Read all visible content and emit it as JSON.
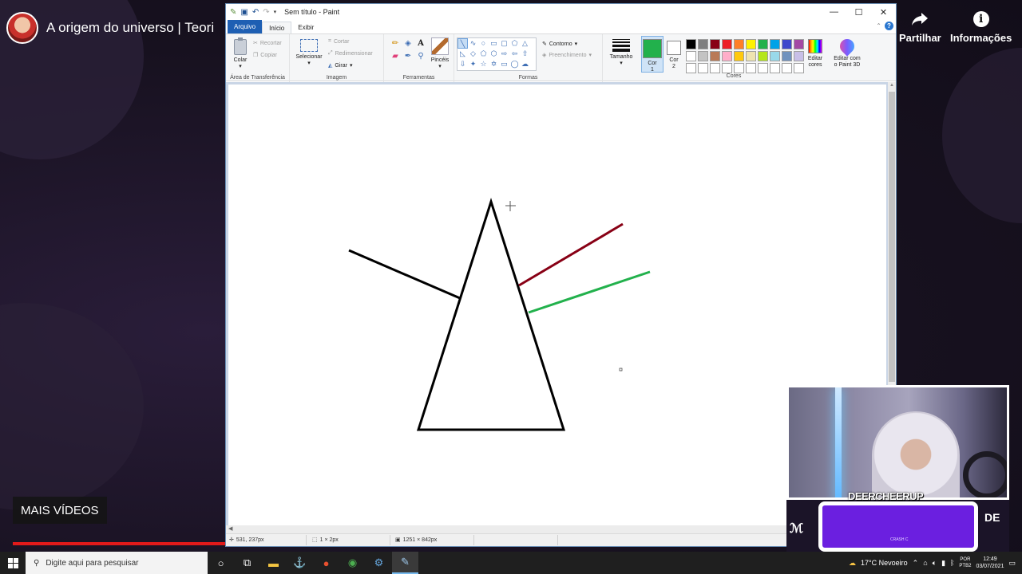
{
  "youtube": {
    "video_title": "A origem do universo | Teori",
    "share_label": "Partilhar",
    "info_label": "Informações",
    "more_videos": "MAIS VÍDEOS"
  },
  "paint": {
    "window_title": "Sem título - Paint",
    "tabs": [
      "Arquivo",
      "Início",
      "Exibir"
    ],
    "clipboard": {
      "paste": "Colar",
      "cut": "Recortar",
      "copy": "Copiar",
      "label": "Área de Transferência"
    },
    "image": {
      "select": "Selecionar",
      "crop": "Cortar",
      "resize": "Redimensionar",
      "rotate": "Girar",
      "label": "Imagem"
    },
    "tools": {
      "brushes": "Pincéis",
      "label": "Ferramentas"
    },
    "shapes": {
      "outline": "Contorno",
      "fill": "Preenchimento",
      "label": "Formas"
    },
    "size_label": "Tamanho",
    "color1": {
      "line1": "Cor",
      "line2": "1",
      "value": "#22b14c"
    },
    "color2": {
      "line1": "Cor",
      "line2": "2",
      "value": "#ffffff"
    },
    "colors_label": "Cores",
    "edit_colors": {
      "line1": "Editar",
      "line2": "cores"
    },
    "paint3d": {
      "line1": "Editar com",
      "line2": "o Paint 3D"
    },
    "palette": [
      "#000000",
      "#7f7f7f",
      "#880015",
      "#ed1c24",
      "#ff7f27",
      "#fff200",
      "#22b14c",
      "#00a2e8",
      "#3f48cc",
      "#a349a4",
      "#ffffff",
      "#c3c3c3",
      "#b97a57",
      "#ffaec9",
      "#ffc90e",
      "#efe4b0",
      "#b5e61d",
      "#99d9ea",
      "#7092be",
      "#c8bfe7",
      "#ffffff",
      "#ffffff",
      "#ffffff",
      "#ffffff",
      "#ffffff",
      "#ffffff",
      "#ffffff",
      "#ffffff",
      "#ffffff",
      "#ffffff"
    ],
    "drawing_colors": {
      "outline": "#000000",
      "red_ray": "#880015",
      "green_ray": "#22b14c"
    },
    "status": {
      "cursor_pos": "531, 237px",
      "selection_size": "1 × 2px",
      "image_size": "1251 × 842px"
    }
  },
  "stream": {
    "streamer_name": "DEERCHEERUP",
    "overlay_text": "DE",
    "overlay_small": "CRASH C"
  },
  "taskbar": {
    "search_placeholder": "Digite aqui para pesquisar",
    "weather": "17°C  Nevoeiro",
    "lang_top": "POR",
    "lang_bottom": "PTB2",
    "time": "12:49",
    "date": "03/07/2021"
  }
}
